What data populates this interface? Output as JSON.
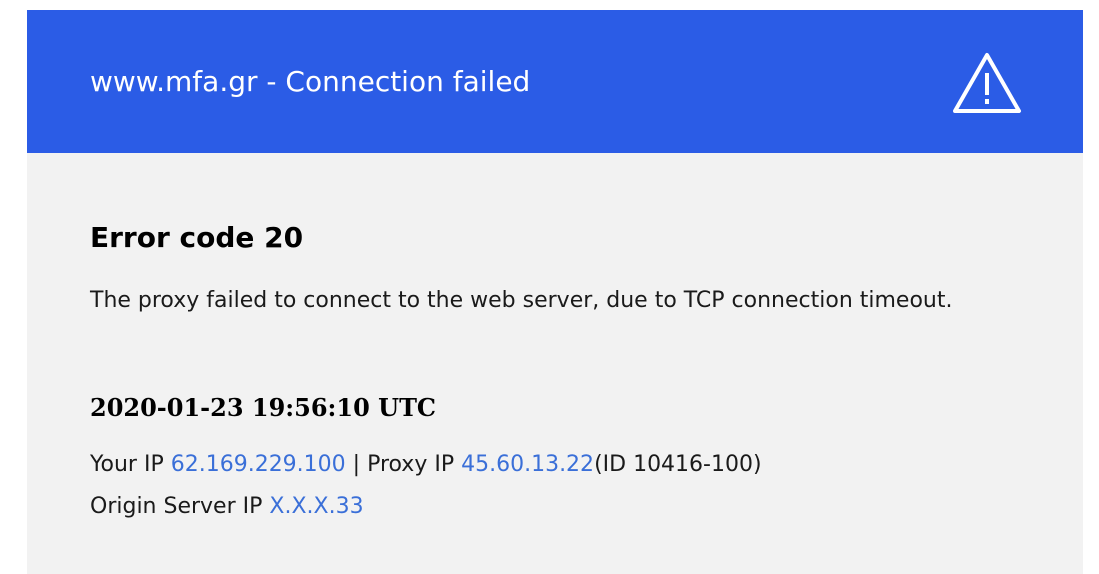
{
  "banner": {
    "title": "www.mfa.gr - Connection failed",
    "icon": "warning-triangle-icon",
    "background": "#2b5ce6"
  },
  "error": {
    "title": "Error code 20",
    "description": "The proxy failed to connect to the web server, due to TCP connection timeout."
  },
  "details": {
    "timestamp": "2020-01-23 19:56:10 UTC",
    "your_ip_label": "Your IP",
    "your_ip": "62.169.229.100",
    "proxy_ip_label": "| Proxy IP",
    "proxy_ip": "45.60.13.22",
    "proxy_id": "(ID 10416-100)",
    "origin_label": "Origin Server IP",
    "origin_ip": "X.X.X.33",
    "link_color": "#3a6fd8"
  }
}
